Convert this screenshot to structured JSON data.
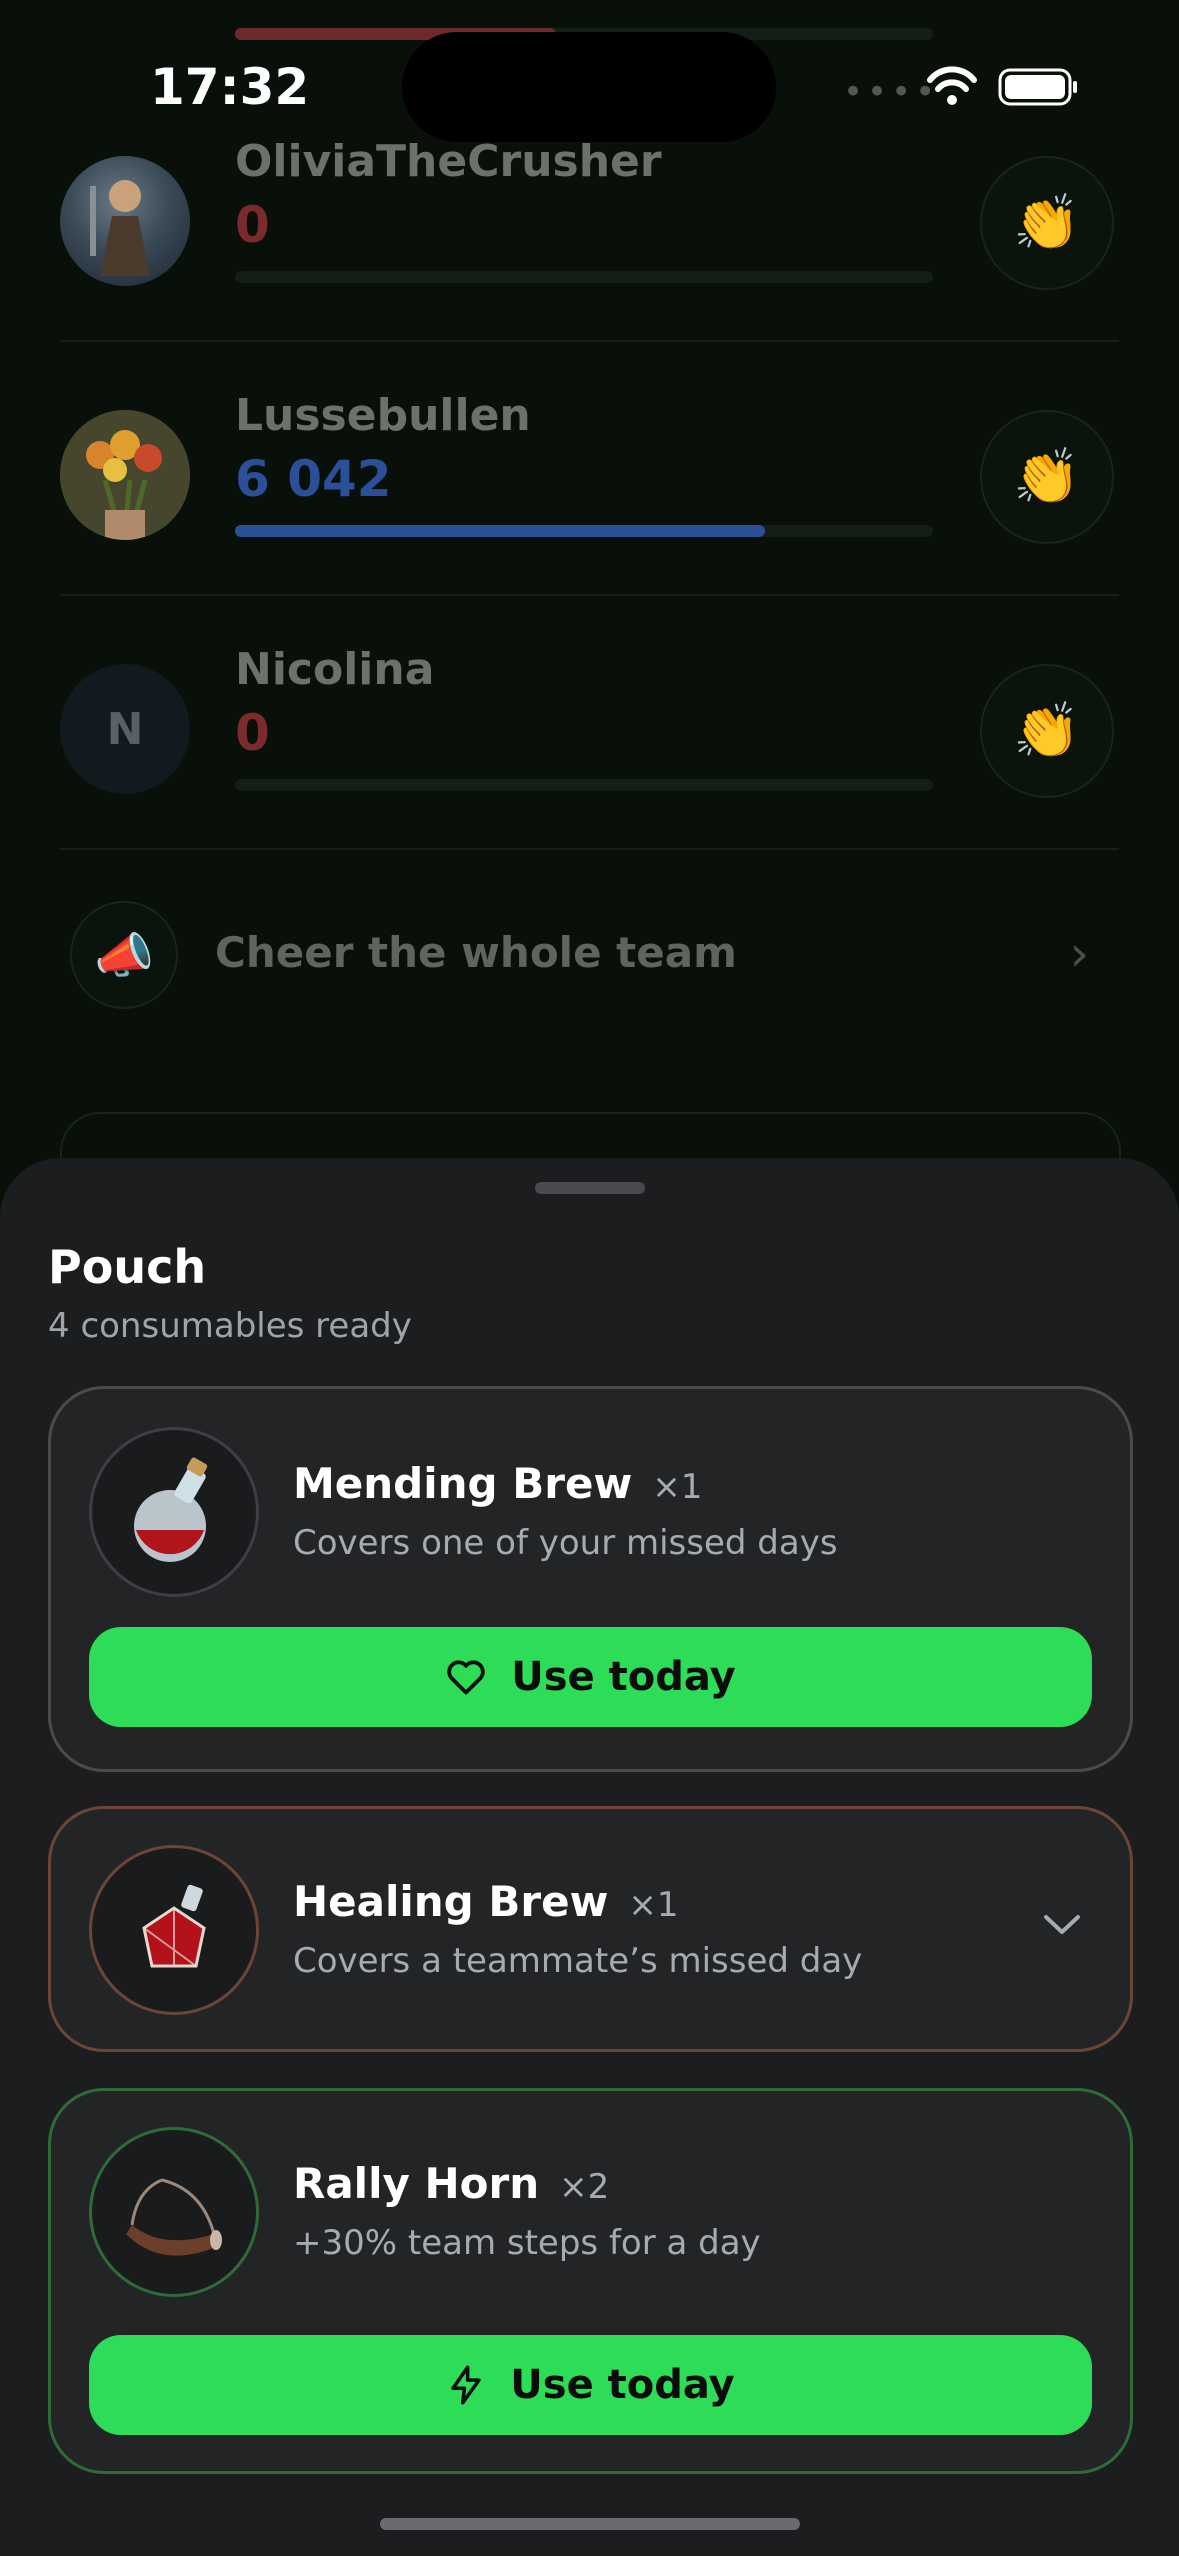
{
  "status": {
    "time": "17:32"
  },
  "team": [
    {
      "name": "OliviaTheCrusher",
      "steps": "0",
      "progress": 0,
      "steps_color": "#7a2b2b"
    },
    {
      "name": "Lussebullen",
      "steps": "6 042",
      "progress": 0.76,
      "steps_color": "#2b4f99"
    },
    {
      "name": "Nicolina",
      "steps": "0",
      "progress": 0,
      "steps_color": "#7a2b2b",
      "initial": "N"
    }
  ],
  "cheer": {
    "label": "Cheer the whole team"
  },
  "pouch": {
    "title": "Pouch",
    "subtitle": "4 consumables ready",
    "items": [
      {
        "name": "Mending Brew",
        "qty": "×1",
        "desc": "Covers one of your missed days",
        "button": "Use today",
        "border": "#4a4b4d"
      },
      {
        "name": "Healing Brew",
        "qty": "×1",
        "desc": "Covers a teammate’s missed day",
        "border": "#6b4636"
      },
      {
        "name": "Rally Horn",
        "qty": "×2",
        "desc": "+30% team steps for a day",
        "button": "Use today",
        "border": "#2f6b37"
      }
    ]
  }
}
